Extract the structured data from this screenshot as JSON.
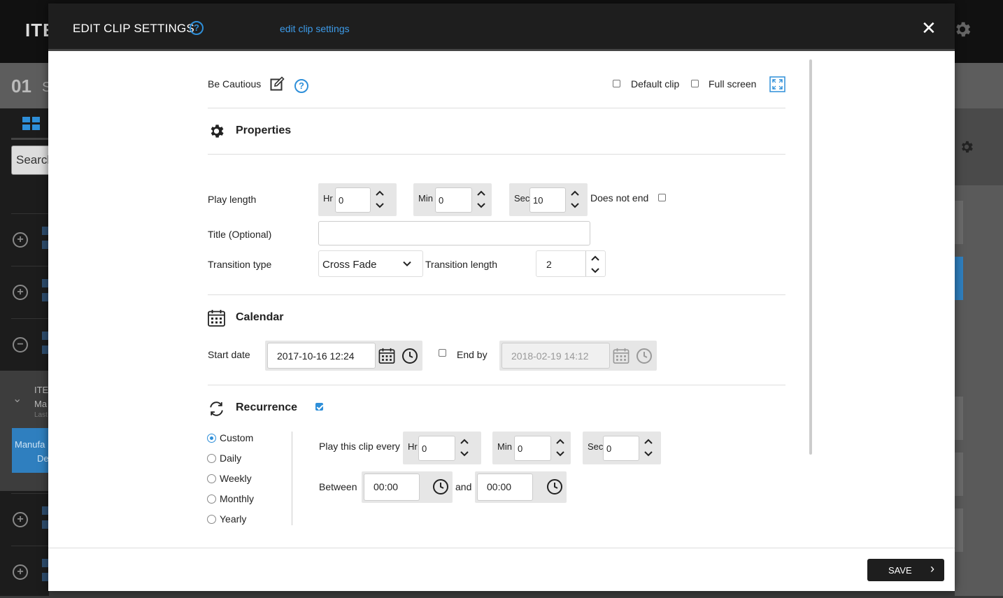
{
  "background": {
    "logo_fragment": "ITE",
    "page_number": "01",
    "page_letter": "S",
    "search_fragment": "Search",
    "expanded_item": {
      "line1": "ITE",
      "line2": "Ma",
      "line3": "Last"
    },
    "blue_card": {
      "line1": "Manufa",
      "line2": "De"
    }
  },
  "modal": {
    "title": "EDIT CLIP SETTINGS",
    "help": "?",
    "subtitle": "edit clip settings",
    "close": "✕",
    "save_label": "SAVE",
    "save_arrow": "›"
  },
  "top_row": {
    "label": "Be Cautious",
    "help": "?",
    "default_clip_label": "Default clip",
    "default_clip_checked": false,
    "full_screen_label": "Full screen",
    "full_screen_checked": false
  },
  "properties": {
    "title": "Properties",
    "play_length_label": "Play length",
    "hr_unit": "Hr",
    "hr_value": "0",
    "min_unit": "Min",
    "min_value": "0",
    "sec_unit": "Sec",
    "sec_value": "10",
    "does_not_end_label": "Does not end",
    "does_not_end_checked": false,
    "title_label": "Title (Optional)",
    "title_value": "",
    "transition_type_label": "Transition type",
    "transition_type_value": "Cross Fade",
    "transition_length_label": "Transition length",
    "transition_length_value": "2"
  },
  "calendar": {
    "title": "Calendar",
    "start_date_label": "Start date",
    "start_date_value": "2017-10-16 12:24",
    "end_by_label": "End by",
    "end_by_checked": false,
    "end_by_value": "2018-02-19 14:12"
  },
  "recurrence": {
    "title": "Recurrence",
    "checked": true,
    "options": [
      "Custom",
      "Daily",
      "Weekly",
      "Monthly",
      "Yearly"
    ],
    "selected": "Custom",
    "play_every_label": "Play this clip every",
    "hr_unit": "Hr",
    "hr_value": "0",
    "min_unit": "Min",
    "min_value": "0",
    "sec_unit": "Sec",
    "sec_value": "0",
    "between_label": "Between",
    "between_start": "00:00",
    "and_label": "and",
    "between_end": "00:00"
  },
  "colors": {
    "accent": "#2e8fd9",
    "header_bg": "#1e1e1e",
    "group_bg": "#e6e6e6"
  }
}
